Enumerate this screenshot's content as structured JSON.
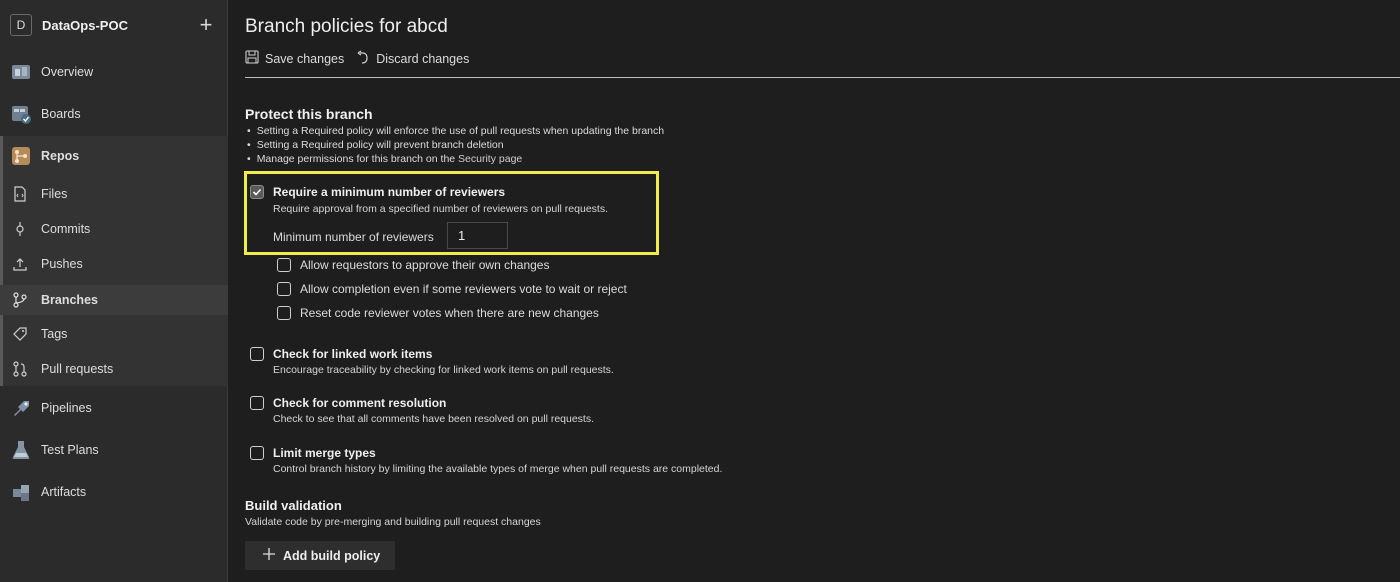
{
  "project": {
    "avatar_letter": "D",
    "name": "DataOps-POC"
  },
  "nav": {
    "overview": "Overview",
    "boards": "Boards",
    "repos": "Repos",
    "files": "Files",
    "commits": "Commits",
    "pushes": "Pushes",
    "branches": "Branches",
    "tags": "Tags",
    "pull_requests": "Pull requests",
    "pipelines": "Pipelines",
    "test_plans": "Test Plans",
    "artifacts": "Artifacts"
  },
  "page": {
    "title": "Branch policies for abcd",
    "save_label": "Save changes",
    "discard_label": "Discard changes"
  },
  "protect": {
    "title": "Protect this branch",
    "bullet1": "Setting a Required policy will enforce the use of pull requests when updating the branch",
    "bullet2": "Setting a Required policy will prevent branch deletion",
    "bullet3_prefix": "Manage permissions for this branch on the ",
    "bullet3_link": "Security page"
  },
  "reviewers": {
    "label": "Require a minimum number of reviewers",
    "desc": "Require approval from a specified number of reviewers on pull requests.",
    "min_label": "Minimum number of reviewers",
    "min_value": "1",
    "checked": true,
    "sub1": "Allow requestors to approve their own changes",
    "sub2": "Allow completion even if some reviewers vote to wait or reject",
    "sub3": "Reset code reviewer votes when there are new changes"
  },
  "linked": {
    "label": "Check for linked work items",
    "desc": "Encourage traceability by checking for linked work items on pull requests."
  },
  "comments": {
    "label": "Check for comment resolution",
    "desc": "Check to see that all comments have been resolved on pull requests."
  },
  "merge": {
    "label": "Limit merge types",
    "desc": "Control branch history by limiting the available types of merge when pull requests are completed."
  },
  "build": {
    "title": "Build validation",
    "desc": "Validate code by pre-merging and building pull request changes",
    "add_label": "Add build policy"
  },
  "colors": {
    "highlight": "#f2ec4b",
    "background": "#1e1e1e",
    "sidebar": "#2b2b2b"
  }
}
